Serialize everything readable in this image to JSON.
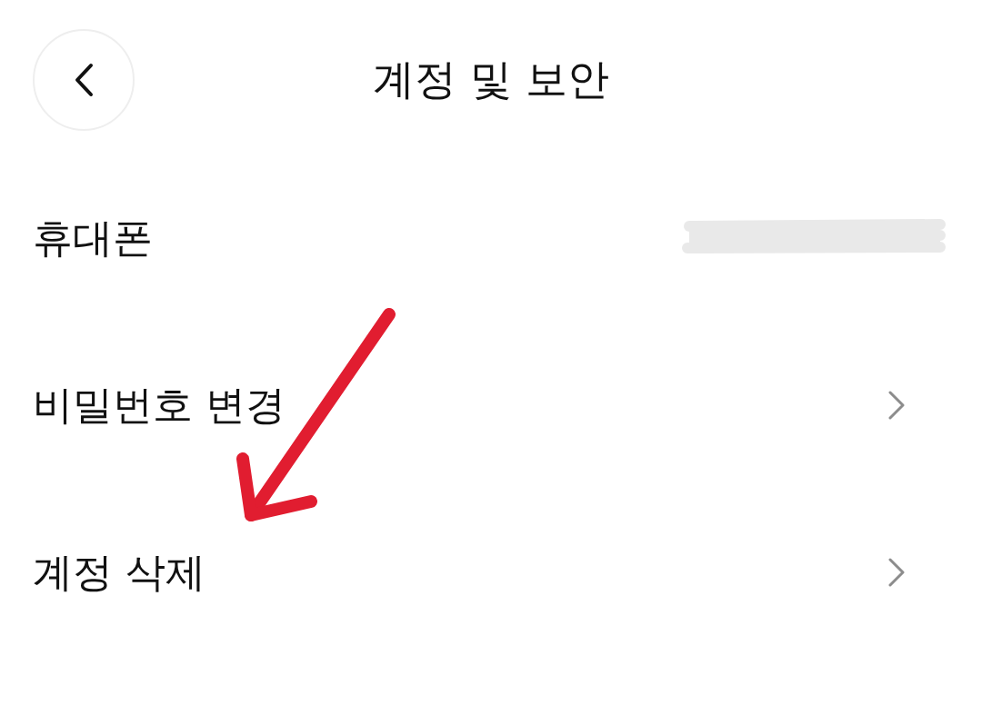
{
  "header": {
    "title": "계정 및 보안"
  },
  "rows": [
    {
      "kind": "value",
      "label": "휴대폰",
      "redacted": true
    },
    {
      "kind": "link",
      "label": "비밀번호 변경"
    },
    {
      "kind": "link",
      "label": "계정 삭제"
    }
  ],
  "annotations": [
    {
      "kind": "arrow"
    }
  ]
}
